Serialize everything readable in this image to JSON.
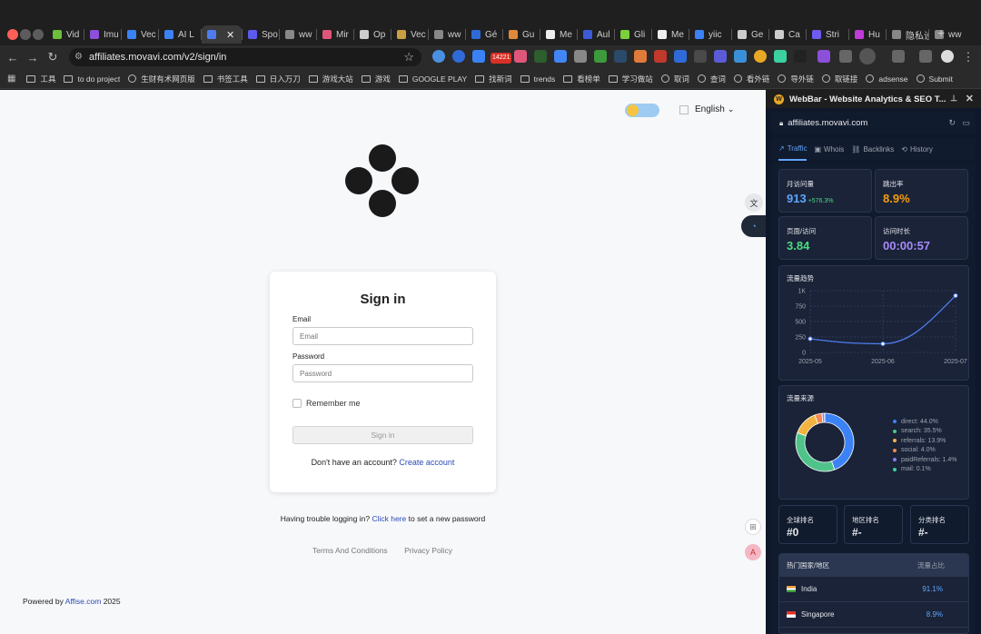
{
  "browser": {
    "tabs": [
      {
        "label": "Vid",
        "color": "#6bbf3b"
      },
      {
        "label": "Imu",
        "color": "#8b4fd9"
      },
      {
        "label": "Vec",
        "color": "#3b82f6"
      },
      {
        "label": "AI L",
        "color": "#3b82f6"
      },
      {
        "label": "",
        "color": "#4f7df0",
        "active": true
      },
      {
        "label": "Spo",
        "color": "#5b5bf0"
      },
      {
        "label": "ww",
        "color": "#888"
      },
      {
        "label": "Mir",
        "color": "#e0567a"
      },
      {
        "label": "Op",
        "color": "#ccc"
      },
      {
        "label": "Vec",
        "color": "#c8a040"
      },
      {
        "label": "ww",
        "color": "#888"
      },
      {
        "label": "Gé",
        "color": "#2f6bd8"
      },
      {
        "label": "Gu",
        "color": "#e0893b"
      },
      {
        "label": "Me",
        "color": "#eee"
      },
      {
        "label": "Aul",
        "color": "#3b5bd8"
      },
      {
        "label": "Gli",
        "color": "#7bd13b"
      },
      {
        "label": "Me",
        "color": "#eee"
      },
      {
        "label": "yiic",
        "color": "#3b82f6"
      },
      {
        "label": "Ge",
        "color": "#ccc"
      },
      {
        "label": "Ca",
        "color": "#ccc"
      },
      {
        "label": "Stri",
        "color": "#6b5bf0"
      },
      {
        "label": "Hu",
        "color": "#c03bd8"
      },
      {
        "label": "隐私设订",
        "color": "#888"
      },
      {
        "label": "ww",
        "color": "#888"
      }
    ],
    "url": "affiliates.movavi.com/v2/sign/in",
    "bookmarks": [
      {
        "label": "工具",
        "type": "folder"
      },
      {
        "label": "to do project",
        "type": "folder"
      },
      {
        "label": "生财有术网页版",
        "type": "site"
      },
      {
        "label": "书签工具",
        "type": "folder"
      },
      {
        "label": "日入万刀",
        "type": "folder"
      },
      {
        "label": "游戏大站",
        "type": "folder"
      },
      {
        "label": "游戏",
        "type": "folder"
      },
      {
        "label": "GOOGLE PLAY",
        "type": "folder"
      },
      {
        "label": "找新词",
        "type": "folder"
      },
      {
        "label": "trends",
        "type": "folder"
      },
      {
        "label": "看榜单",
        "type": "folder"
      },
      {
        "label": "学习做站",
        "type": "folder"
      },
      {
        "label": "取词",
        "type": "site"
      },
      {
        "label": "查词",
        "type": "site"
      },
      {
        "label": "看外链",
        "type": "site"
      },
      {
        "label": "导外链",
        "type": "site"
      },
      {
        "label": "取链接",
        "type": "site"
      },
      {
        "label": "adsense",
        "type": "site"
      },
      {
        "label": "Submit",
        "type": "site"
      }
    ],
    "badge_text": "14221"
  },
  "page": {
    "language": "English",
    "title": "Sign in",
    "email_label": "Email",
    "email_placeholder": "Email",
    "password_label": "Password",
    "password_placeholder": "Password",
    "remember_label": "Remember me",
    "signin_button": "Sign in",
    "no_account_text": "Don't have an account?",
    "create_account": "Create account",
    "trouble_prefix": "Having trouble logging in?",
    "click_here": "Click here",
    "trouble_suffix": "to set a new password",
    "terms": "Terms And Conditions",
    "privacy": "Privacy Policy",
    "powered_prefix": "Powered by",
    "powered_link": "Affise.com",
    "powered_year": "2025"
  },
  "webbar": {
    "title": "WebBar - Website Analytics & SEO T...",
    "domain": "affiliates.movavi.com",
    "tabs": [
      "Traffic",
      "Whois",
      "Backlinks",
      "History"
    ],
    "monthly_visits_label": "月访问量",
    "monthly_visits": "913",
    "monthly_change": "+576.3%",
    "bounce_label": "跳出率",
    "bounce": "8.9%",
    "pages_label": "页面/访问",
    "pages": "3.84",
    "duration_label": "访问时长",
    "duration": "00:00:57",
    "trend_label": "流量趋势",
    "sources_label": "流量来源",
    "global_rank_label": "全球排名",
    "global_rank": "#0",
    "region_rank_label": "地区排名",
    "region_rank": "#-",
    "category_rank_label": "分类排名",
    "category_rank": "#-",
    "countries_label": "热门国家/地区",
    "share_label": "流量占比",
    "countries": [
      {
        "name": "India",
        "share": "91.1%"
      },
      {
        "name": "Singapore",
        "share": "8.9%"
      }
    ],
    "colors": {
      "bounce": "#f59e0b",
      "pages": "#4ade80",
      "duration": "#a78bfa",
      "visits": "#60a5fa"
    }
  },
  "chart_data": [
    {
      "type": "line",
      "title": "流量趋势",
      "x": [
        "2025-05",
        "2025-06",
        "2025-07"
      ],
      "series": [
        {
          "values": [
            220,
            140,
            920
          ]
        }
      ],
      "yticks": [
        "0",
        "250",
        "500",
        "750",
        "1K"
      ],
      "ylim": [
        0,
        1000
      ]
    },
    {
      "type": "pie",
      "title": "流量来源",
      "labels": [
        "direct",
        "search",
        "referrals",
        "social",
        "paidReferrals",
        "mail"
      ],
      "values": [
        44.0,
        35.5,
        13.9,
        4.0,
        1.4,
        0.1
      ],
      "legend": [
        "direct: 44.0%",
        "search: 35.5%",
        "referrals: 13.9%",
        "social: 4.0%",
        "paidReferrals: 1.4%",
        "mail: 0.1%"
      ],
      "colors": [
        "#3b82f6",
        "#4fc38a",
        "#f2b441",
        "#f08a4b",
        "#8b7cf6",
        "#3bd0a0"
      ]
    }
  ]
}
